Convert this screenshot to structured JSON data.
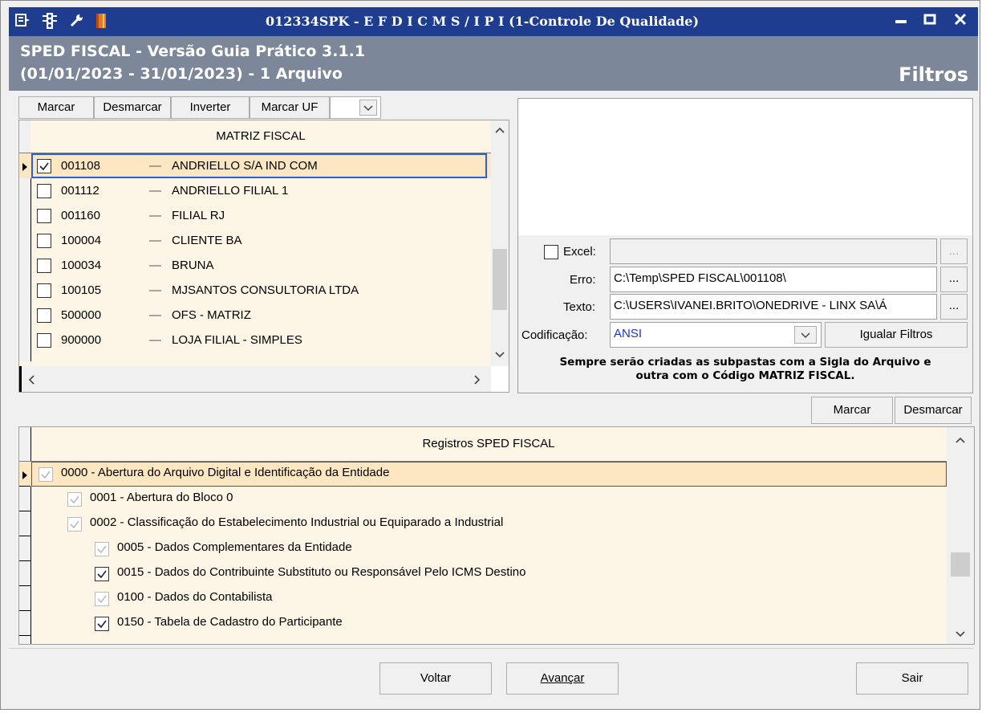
{
  "window": {
    "title": "012334SPK - E F D  I C M S / I P I (1-Controle De Qualidade)",
    "minimize": "▬",
    "maximize": "▢",
    "close": "X"
  },
  "header": {
    "line1": "SPED FISCAL - Versão Guia Prático 3.1.1",
    "line2": "(01/01/2023 - 31/01/2023) - 1 Arquivo",
    "section": "Filtros"
  },
  "toolbar": {
    "marcar": "Marcar",
    "desmarcar": "Desmarcar",
    "inverter": "Inverter",
    "marcar_uf": "Marcar UF"
  },
  "matriz": {
    "header": "MATRIZ FISCAL",
    "rows": [
      {
        "code": "001108",
        "name": "ANDRIELLO S/A IND COM",
        "checked": true
      },
      {
        "code": "001112",
        "name": "ANDRIELLO FILIAL 1",
        "checked": false
      },
      {
        "code": "001160",
        "name": "FILIAL RJ",
        "checked": false
      },
      {
        "code": "100004",
        "name": "CLIENTE BA",
        "checked": false
      },
      {
        "code": "100034",
        "name": "BRUNA",
        "checked": false
      },
      {
        "code": "100105",
        "name": "MJSANTOS CONSULTORIA LTDA",
        "checked": false
      },
      {
        "code": "500000",
        "name": "OFS - MATRIZ",
        "checked": false
      },
      {
        "code": "900000",
        "name": "LOJA FILIAL - SIMPLES",
        "checked": false
      }
    ],
    "separator": "—"
  },
  "filters": {
    "excel_label": "Excel:",
    "excel_value": "",
    "erro_label": "Erro:",
    "erro_value": "C:\\Temp\\SPED FISCAL\\001108\\",
    "texto_label": "Texto:",
    "texto_value": "C:\\USERS\\IVANEI.BRITO\\ONEDRIVE - LINX SA\\Á",
    "codif_label": "Codificação:",
    "codif_value": "ANSI",
    "browse": "...",
    "igualar": "Igualar Filtros",
    "note1": "Sempre serão criadas as subpastas com a Sigla do Arquivo e",
    "note2": "outra com o Código MATRIZ FISCAL."
  },
  "registros": {
    "marcar": "Marcar",
    "desmarcar": "Desmarcar",
    "header": "Registros SPED FISCAL",
    "rows": [
      {
        "text": "0000 - Abertura do Arquivo Digital e Identificação da Entidade",
        "level": 0,
        "state": "grey"
      },
      {
        "text": "0001 - Abertura do Bloco 0",
        "level": 1,
        "state": "grey"
      },
      {
        "text": "0002 - Classificação do Estabelecimento Industrial ou Equiparado a Industrial",
        "level": 1,
        "state": "grey"
      },
      {
        "text": "0005 - Dados Complementares da Entidade",
        "level": 2,
        "state": "grey"
      },
      {
        "text": "0015 - Dados do Contribuinte Substituto ou Responsável Pelo ICMS Destino",
        "level": 2,
        "state": "checked"
      },
      {
        "text": "0100 - Dados do Contabilista",
        "level": 2,
        "state": "grey"
      },
      {
        "text": "0150 - Tabela de Cadastro do Participante",
        "level": 2,
        "state": "checked"
      }
    ]
  },
  "footer": {
    "voltar": "Voltar",
    "avancar": "Avançar",
    "sair": "Sair"
  }
}
